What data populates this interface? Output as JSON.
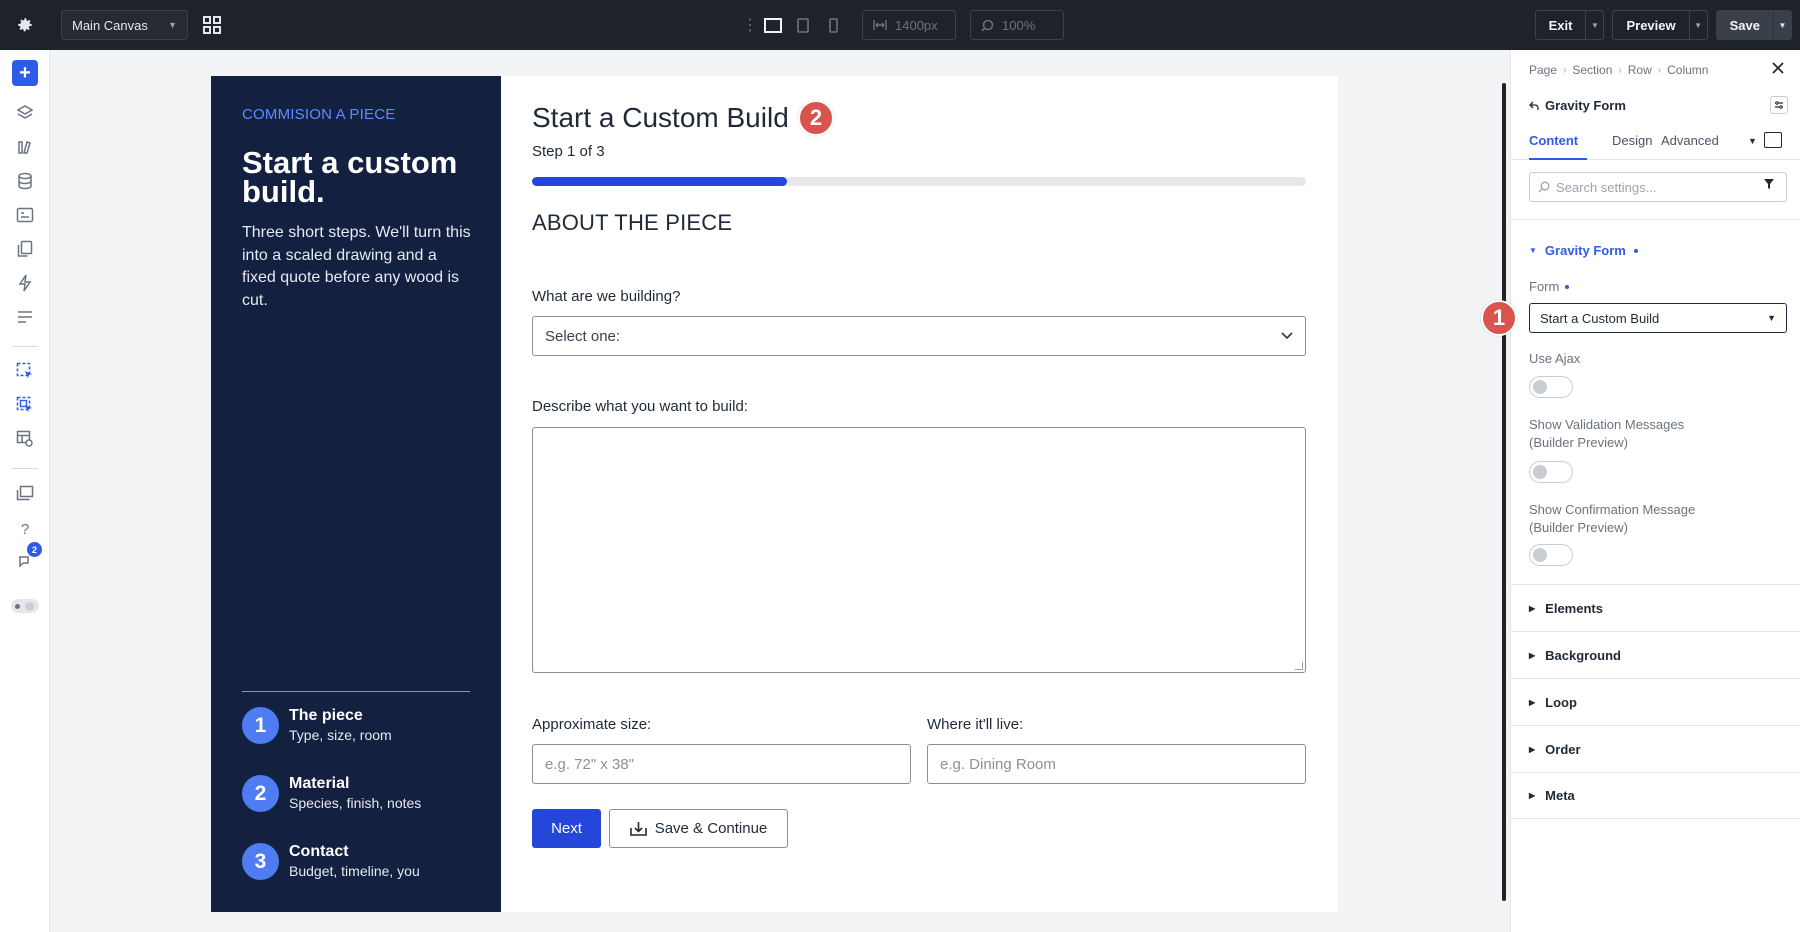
{
  "topbar": {
    "canvas_select": "Main Canvas",
    "width_value": "1400px",
    "zoom_value": "100%",
    "exit_label": "Exit",
    "preview_label": "Preview",
    "save_label": "Save"
  },
  "rail": {
    "notification_count": "2"
  },
  "content": {
    "eyebrow": "COMMISION A PIECE",
    "side_title": "Start a custom build.",
    "side_description": "Three short steps. We'll turn this into a scaled drawing and a fixed quote before any wood is cut.",
    "steps": [
      {
        "number": "1",
        "title": "The piece",
        "subtitle": "Type, size, room"
      },
      {
        "number": "2",
        "title": "Material",
        "subtitle": "Species, finish, notes"
      },
      {
        "number": "3",
        "title": "Contact",
        "subtitle": "Budget, timeline, you"
      }
    ]
  },
  "form": {
    "title": "Start a Custom Build",
    "step_text": "Step 1 of 3",
    "progress_fraction": 0.33,
    "section_title": "ABOUT THE PIECE",
    "q1_label": "What are we building?",
    "q1_value": "Select one:",
    "q2_label": "Describe what you want to build:",
    "q3_label": "Approximate size:",
    "q3_placeholder": "e.g. 72\" x 38\"",
    "q4_label": "Where it'll live:",
    "q4_placeholder": "e.g. Dining Room",
    "next_label": "Next",
    "save_continue_label": "Save & Continue"
  },
  "markers": {
    "one": "1",
    "two": "2"
  },
  "panel": {
    "breadcrumb": [
      "Page",
      "Section",
      "Row",
      "Column"
    ],
    "module_name": "Gravity Form",
    "tabs": [
      "Content",
      "Design",
      "Advanced"
    ],
    "search_placeholder": "Search settings...",
    "group_title": "Gravity Form",
    "form_label": "Form",
    "form_value": "Start a Custom Build",
    "use_ajax_label": "Use Ajax",
    "show_validation_label_1": "Show Validation Messages",
    "show_validation_label_2": "(Builder Preview)",
    "show_confirmation_label_1": "Show Confirmation Message",
    "show_confirmation_label_2": "(Builder Preview)",
    "accordions": [
      "Elements",
      "Background",
      "Loop",
      "Order",
      "Meta"
    ]
  },
  "colors": {
    "accent": "#2f5bea",
    "topbar": "#1e2229",
    "sidebar_navy": "#142040",
    "progress": "#2446d9",
    "marker": "#d9534f"
  }
}
